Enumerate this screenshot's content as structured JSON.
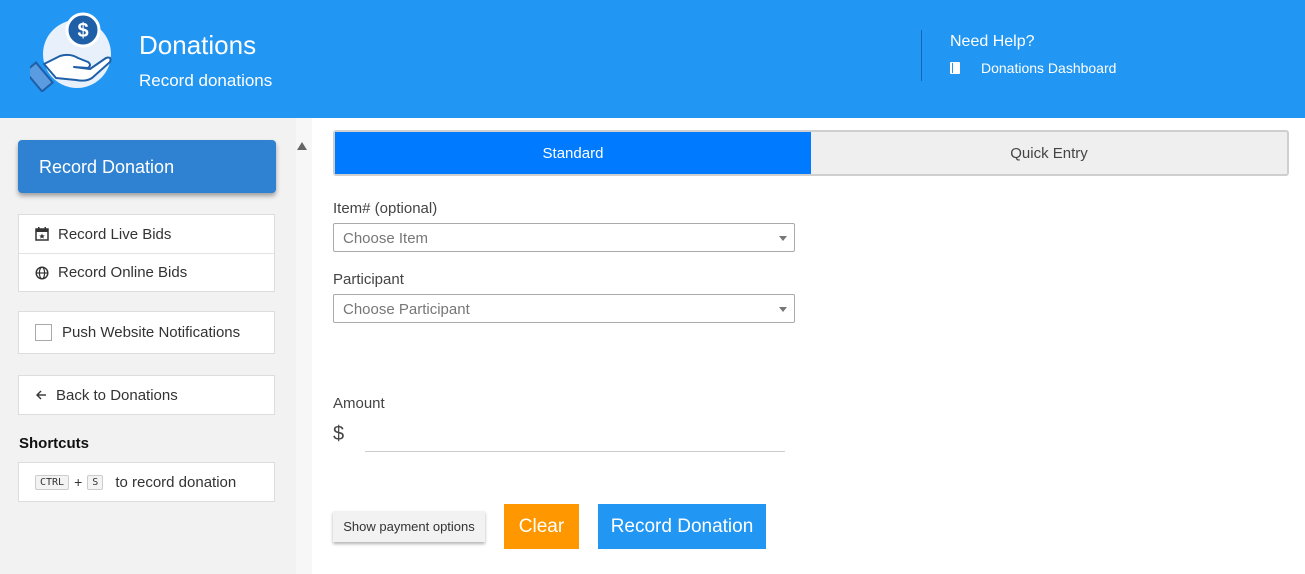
{
  "header": {
    "title": "Donations",
    "subtitle": "Record donations",
    "help_title": "Need Help?",
    "help_link": "Donations Dashboard"
  },
  "sidebar": {
    "primary_button": "Record Donation",
    "links": [
      {
        "label": "Record Live Bids",
        "icon": "calendar-star-icon"
      },
      {
        "label": "Record Online Bids",
        "icon": "globe-icon"
      }
    ],
    "push_notifications": {
      "label": "Push Website Notifications",
      "checked": false
    },
    "back_link": "Back to Donations",
    "shortcuts_title": "Shortcuts",
    "shortcut": {
      "key1": "CTRL",
      "plus": "+",
      "key2": "S",
      "description": "to record donation"
    }
  },
  "main": {
    "tabs": [
      {
        "label": "Standard",
        "active": true
      },
      {
        "label": "Quick Entry",
        "active": false
      }
    ],
    "item_label": "Item# (optional)",
    "item_placeholder": "Choose Item",
    "participant_label": "Participant",
    "participant_placeholder": "Choose Participant",
    "amount_label": "Amount",
    "currency_symbol": "$",
    "amount_value": "",
    "buttons": {
      "payment_options": "Show payment options",
      "clear": "Clear",
      "record": "Record Donation"
    }
  },
  "colors": {
    "header_bg": "#2196f3",
    "primary_button": "#2e82d1",
    "tab_active": "#007bff",
    "clear_button": "#ff9800",
    "record_button": "#2196f3"
  }
}
